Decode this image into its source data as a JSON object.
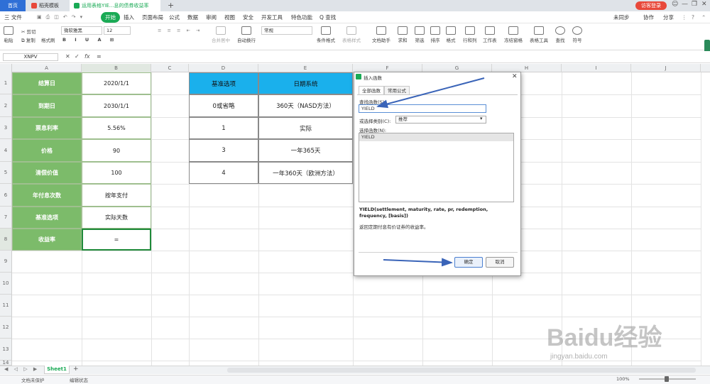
{
  "titlebar": {
    "home_tab": "首页",
    "doc_tab": "稻壳模板",
    "active_tab": "运用表格YIE...息的债券收益率",
    "new_tab": "+",
    "login": "访客登录"
  },
  "menu": {
    "file": "三 文件",
    "items": [
      "开始",
      "插入",
      "页面布局",
      "公式",
      "数据",
      "审阅",
      "视图",
      "安全",
      "开发工具",
      "特色功能"
    ],
    "search": "Q 查找",
    "sync": "未同步",
    "collab": "协作",
    "share": "分享"
  },
  "ribbon": {
    "paste": "粘贴",
    "cut": "剪切",
    "copy": "复制",
    "format_painter": "格式刷",
    "font_name": "微软雅黑",
    "font_size": "12",
    "merge": "合并居中",
    "wrap": "自动换行",
    "number_format": "常规",
    "cond_format": "条件格式",
    "table_style": "表格样式",
    "doc_assist": "文档助手",
    "sum": "求和",
    "filter": "筛选",
    "sort": "排序",
    "format": "格式",
    "rowcol": "行和列",
    "worksheet": "工作表",
    "freeze": "冻结窗格",
    "table_tools": "表格工具",
    "find": "查找",
    "symbol": "符号"
  },
  "formula_bar": {
    "name_box": "XNPV",
    "fx": "fx",
    "formula": "="
  },
  "columns": [
    "A",
    "B",
    "C",
    "D",
    "E",
    "F",
    "G",
    "H",
    "I",
    "J"
  ],
  "rows": [
    "1",
    "2",
    "3",
    "4",
    "5",
    "6",
    "7",
    "8",
    "9",
    "10",
    "11",
    "12",
    "13",
    "14"
  ],
  "table_left": [
    {
      "label": "结算日",
      "value": "2020/1/1"
    },
    {
      "label": "到期日",
      "value": "2030/1/1"
    },
    {
      "label": "票息利率",
      "value": "5.56%"
    },
    {
      "label": "价格",
      "value": "90"
    },
    {
      "label": "清偿价值",
      "value": "100"
    },
    {
      "label": "年付息次数",
      "value": "按年支付"
    },
    {
      "label": "基准选项",
      "value": "实际天数"
    },
    {
      "label": "收益率",
      "value": "="
    }
  ],
  "table_basis": {
    "headers": [
      "基准选项",
      "日期系统"
    ],
    "rows": [
      [
        "0或省略",
        "360天（NASD方法）"
      ],
      [
        "1",
        "实际"
      ],
      [
        "3",
        "一年365天"
      ],
      [
        "4",
        "一年360天（欧洲方法）"
      ]
    ]
  },
  "dialog": {
    "title": "插入函数",
    "tabs": [
      "全部函数",
      "常用公式"
    ],
    "search_label": "查找函数(S):",
    "search_value": "YIELD",
    "category_label": "或选择类别(C):",
    "category_value": "推荐",
    "select_label": "选择函数(N):",
    "list": [
      "YIELD"
    ],
    "signature": "YIELD(settlement, maturity, rate, pr, redemption, frequency, [basis])",
    "description": "返回定期付息有价证券的收益率。",
    "ok": "确定",
    "cancel": "取消"
  },
  "sheets": [
    "Sheet1"
  ],
  "status": {
    "left1": "文档未保护",
    "left2": "编辑状态",
    "zoom": "100%"
  },
  "watermark": {
    "text": "Baidu经验",
    "url": "jingyan.baidu.com"
  },
  "colors": {
    "label_green": "#7cbb6a",
    "header_blue": "#1ab0ec",
    "accent_green": "#1aaa55",
    "arrow_blue": "#3a64b8"
  }
}
